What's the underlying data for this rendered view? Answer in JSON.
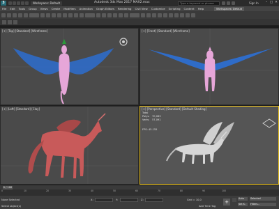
{
  "titlebar": {
    "logo": "3",
    "workspace": "Workspace: Default",
    "title": "Autodesk 3ds Max 2017    MAX2.max",
    "search_placeholder": "Type a keyword or phrase",
    "signin": "Sign In",
    "minimize": "–",
    "maximize": "□",
    "close": "✕"
  },
  "menu": {
    "items": [
      "File",
      "Edit",
      "Tools",
      "Group",
      "Views",
      "Create",
      "Modifiers",
      "Animation",
      "Graph Editors",
      "Rendering",
      "Civil View",
      "Customize",
      "Scripting",
      "Content",
      "Help"
    ],
    "workspaces_label": "Workspaces: Default"
  },
  "viewports": {
    "top": {
      "label": "[+] [Top] [Standard] [Wireframe]"
    },
    "front": {
      "label": "[+] [Front] [Standard] [Wireframe]"
    },
    "left": {
      "label": "[+] [Left] [Standard] [Clay]"
    },
    "perspective": {
      "label": "[+] [Perspective] [Standard] [Default Shading]",
      "stats": [
        {
          "name": "Total",
          "value": ""
        },
        {
          "name": "Polys:",
          "value": "70,063"
        },
        {
          "name": "Verts:",
          "value": "57,091"
        }
      ],
      "fps_label": "FPS:",
      "fps_value": "45.155"
    }
  },
  "timeline": {
    "frame_counter": "0 / 100",
    "ticks": [
      "0",
      "10",
      "20",
      "30",
      "40",
      "50",
      "60",
      "70",
      "80",
      "90",
      "100"
    ]
  },
  "statusbar": {
    "status": "None Selected",
    "prompt": "Select object(s)",
    "x_label": "X:",
    "y_label": "Y:",
    "z_label": "Z:",
    "grid": "Grid = 10,0",
    "add_time_tag": "Add Time Tag",
    "auto_key": "Auto",
    "set_key": "Set K.",
    "selected": "Selected",
    "filters": "Filters..."
  },
  "colors": {
    "viewport_bg": "#4a4a4a",
    "active_border": "#e8c020",
    "wing_blue": "#2f6cc8",
    "body_pink": "#e6a6d8",
    "clay": "#c85a5a"
  }
}
